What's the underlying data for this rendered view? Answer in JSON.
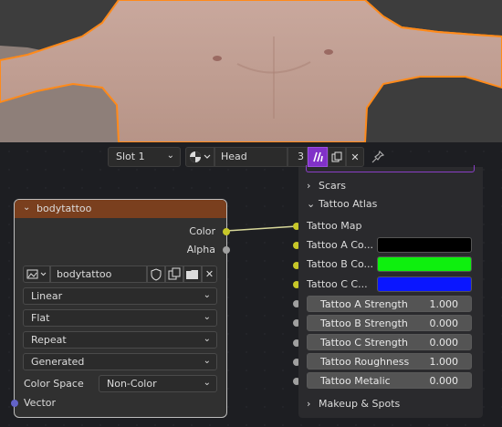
{
  "viewport": {
    "name": "3d-viewport"
  },
  "header": {
    "slot_label": "Slot 1",
    "material_name": "Head",
    "user_count": "3",
    "colors": {
      "fake_user_active": "#8131c8"
    }
  },
  "node": {
    "title": "bodytattoo",
    "outputs": [
      "Color",
      "Alpha"
    ],
    "image_name": "bodytattoo",
    "interpolation": "Linear",
    "projection": "Flat",
    "extension": "Repeat",
    "source": "Generated",
    "color_space_label": "Color Space",
    "color_space_value": "Non-Color",
    "input_label": "Vector",
    "header_color": "#7a3f1e"
  },
  "panel": {
    "scars_label": "Scars",
    "atlas_label": "Tattoo Atlas",
    "map_label": "Tattoo Map",
    "colors": [
      {
        "label": "Tattoo A Co...",
        "value": "#000000"
      },
      {
        "label": "Tattoo B Co...",
        "value": "#0ef00e"
      },
      {
        "label": "Tattoo C C...",
        "value": "#0a16ff"
      }
    ],
    "values": [
      {
        "label": "Tattoo A Strength",
        "value": "1.000"
      },
      {
        "label": "Tattoo B Strength",
        "value": "0.000"
      },
      {
        "label": "Tattoo C Strength",
        "value": "0.000"
      },
      {
        "label": "Tattoo Roughness",
        "value": "1.000"
      },
      {
        "label": "Tattoo Metalic",
        "value": "0.000"
      }
    ],
    "makeup_label": "Makeup & Spots"
  }
}
